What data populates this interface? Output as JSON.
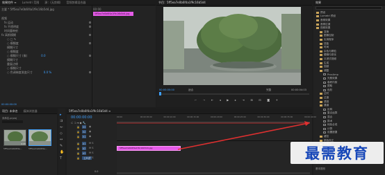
{
  "top_tabs": {
    "left": [
      "效果控件 ≡",
      "Lumetri 范围",
      "源：(无剪辑)",
      "音频剪辑混合器"
    ],
    "program": "节目：5ff5ea7e0b6f4a1f9c16b5d4",
    "right": "效果"
  },
  "effect_controls": {
    "master": "主要 * 5ff5ea7e0b6f4a1f9c16b5d4.jpg",
    "clip_label": "5ff5ea7e0b6f4a1f9c16b5d4.jpg",
    "time_mini": "00:00",
    "rows": [
      {
        "indent": 0,
        "label": "视频"
      },
      {
        "indent": 1,
        "label": "fx  运动"
      },
      {
        "indent": 1,
        "label": "fx  不透明度"
      },
      {
        "indent": 1,
        "label": "时间重映射"
      },
      {
        "indent": 0,
        "label": "fx  高斯模糊"
      },
      {
        "indent": 2,
        "label": "○ □ ✎"
      },
      {
        "indent": 2,
        "label": "○ 模糊度",
        "value": ""
      },
      {
        "indent": 2,
        "label": "模糊尺寸",
        "value": ""
      },
      {
        "indent": 2,
        "label": "○ 模糊度",
        "value": ""
      },
      {
        "indent": 2,
        "label": "○ 模糊尺寸 (像)",
        "value": "0.0"
      },
      {
        "indent": 2,
        "label": "模糊尺寸",
        "value": ""
      },
      {
        "indent": 2,
        "label": "重复边缘",
        "value": ""
      },
      {
        "indent": 2,
        "label": "○ 模糊尺寸",
        "value": ""
      },
      {
        "indent": 2,
        "label": "○ 色调梯度渐变尺寸",
        "value": "0.0 %"
      }
    ],
    "timecode": "00:00:00:00"
  },
  "program": {
    "timecode_left": "00:00:00:00",
    "fit": "适合",
    "quality": "完整",
    "timecode_right": "00:00:04:03"
  },
  "project": {
    "tabs": [
      "项目: 未命名",
      "媒体浏览器"
    ],
    "file_label": "未命名.prproj",
    "thumbs": [
      {
        "name": "5ff5ea7e0b6f4a...",
        "dur": "4:29"
      },
      {
        "name": "5ff5ea7e0b6f4a...",
        "dur": ""
      }
    ]
  },
  "timeline": {
    "tab": "5ff5ea7e0b6f4a1f9c16b5d4 ≡",
    "timecode": "00:00:00:00",
    "ruler": [
      "00:00",
      "00:00:05:00",
      "00:00:10:00",
      "00:00:15:00",
      "00:00:20:00",
      "00:00:25:00",
      "00:00:30:00",
      "00:00:35:00",
      "00:00:40:00"
    ],
    "tracks": [
      "V3",
      "V2",
      "V1",
      "A1",
      "A2",
      "A3",
      "主声道"
    ],
    "clip_name": "5ff5ea7e0b6f4a1f9c16b5d4.jpg",
    "master_val": "0.0"
  },
  "effects_tree": [
    {
      "indent": 0,
      "type": "folder",
      "label": "预设"
    },
    {
      "indent": 0,
      "type": "folder",
      "label": "Lumetri 预设"
    },
    {
      "indent": 0,
      "type": "folder",
      "label": "音频效果"
    },
    {
      "indent": 0,
      "type": "folder",
      "label": "音频过渡"
    },
    {
      "indent": 0,
      "type": "folder",
      "label": "视频效果"
    },
    {
      "indent": 1,
      "type": "folder",
      "label": "变换"
    },
    {
      "indent": 1,
      "type": "folder",
      "label": "图像控制"
    },
    {
      "indent": 1,
      "type": "folder",
      "label": "实用程序"
    },
    {
      "indent": 1,
      "type": "folder",
      "label": "扭曲"
    },
    {
      "indent": 1,
      "type": "folder",
      "label": "时间"
    },
    {
      "indent": 1,
      "type": "folder",
      "label": "杂色与颗粒"
    },
    {
      "indent": 1,
      "type": "folder",
      "label": "模糊与锐化"
    },
    {
      "indent": 1,
      "type": "folder",
      "label": "沉浸式视频"
    },
    {
      "indent": 1,
      "type": "folder",
      "label": "生成"
    },
    {
      "indent": 1,
      "type": "folder",
      "label": "视频"
    },
    {
      "indent": 1,
      "type": "folder",
      "label": "调整"
    },
    {
      "indent": 2,
      "type": "fx",
      "label": "ProcAmp"
    },
    {
      "indent": 2,
      "type": "fx",
      "label": "光照效果"
    },
    {
      "indent": 2,
      "type": "fx",
      "label": "卷积内核"
    },
    {
      "indent": 2,
      "type": "fx",
      "label": "提取"
    },
    {
      "indent": 2,
      "type": "fx",
      "label": "色阶"
    },
    {
      "indent": 1,
      "type": "folder",
      "label": "过时"
    },
    {
      "indent": 1,
      "type": "folder",
      "label": "过渡"
    },
    {
      "indent": 1,
      "type": "folder",
      "label": "透视"
    },
    {
      "indent": 1,
      "type": "folder",
      "label": "通道"
    },
    {
      "indent": 2,
      "type": "fx",
      "label": "反转"
    },
    {
      "indent": 2,
      "type": "fx",
      "label": "复合运算"
    },
    {
      "indent": 2,
      "type": "fx",
      "label": "混合"
    },
    {
      "indent": 2,
      "type": "fx",
      "label": "算术"
    },
    {
      "indent": 2,
      "type": "fx",
      "label": "纯色合成"
    },
    {
      "indent": 2,
      "type": "fx",
      "label": "计算"
    },
    {
      "indent": 2,
      "type": "fx",
      "label": "设置遮罩"
    },
    {
      "indent": 1,
      "type": "folder",
      "label": "键控"
    },
    {
      "indent": 1,
      "type": "folder",
      "label": "颜色校正"
    },
    {
      "indent": 1,
      "type": "folder",
      "label": "风格化"
    },
    {
      "indent": 0,
      "type": "folder",
      "label": "视频过渡"
    }
  ],
  "effects_footer": [
    "基本声音",
    "基本图形"
  ],
  "watermark": "最需教育",
  "colors": {
    "accent": "#3ea0ff",
    "clip": "#e55ce8",
    "arrow": "#e03030"
  }
}
